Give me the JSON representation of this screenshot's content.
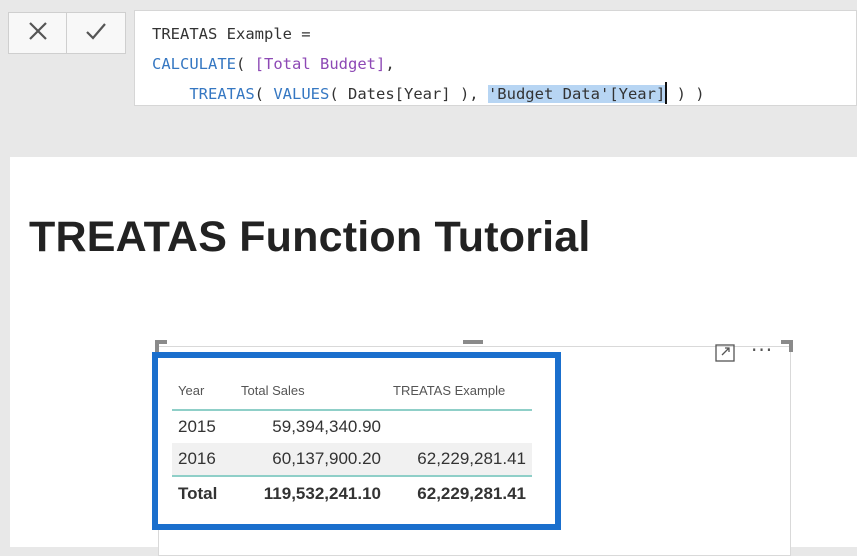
{
  "formula_bar": {
    "cancel_icon": "close-icon",
    "commit_icon": "check-icon",
    "line1": "TREATAS Example =",
    "line2_fn": "CALCULATE",
    "line2_rest": "( ",
    "line2_measure": "[Total Budget]",
    "line2_end": ",",
    "line3_indent": "    ",
    "line3_fn": "TREATAS",
    "line3_mid1": "( ",
    "line3_fn2": "VALUES",
    "line3_mid2": "( Dates[Year] ), ",
    "line3_selected": "'Budget Data'[Year]",
    "line3_end": " ) )"
  },
  "page": {
    "title": "TREATAS Function Tutorial"
  },
  "visual": {
    "focus_icon": "focus-mode-icon",
    "more_icon": "more-options-icon",
    "highlight_color": "#1a6fcd",
    "table": {
      "headers": [
        "Year",
        "Total Sales",
        "TREATAS Example"
      ],
      "rows": [
        [
          "2015",
          "59,394,340.90",
          ""
        ],
        [
          "2016",
          "60,137,900.20",
          "62,229,281.41"
        ]
      ],
      "total": [
        "Total",
        "119,532,241.10",
        "62,229,281.41"
      ]
    }
  }
}
